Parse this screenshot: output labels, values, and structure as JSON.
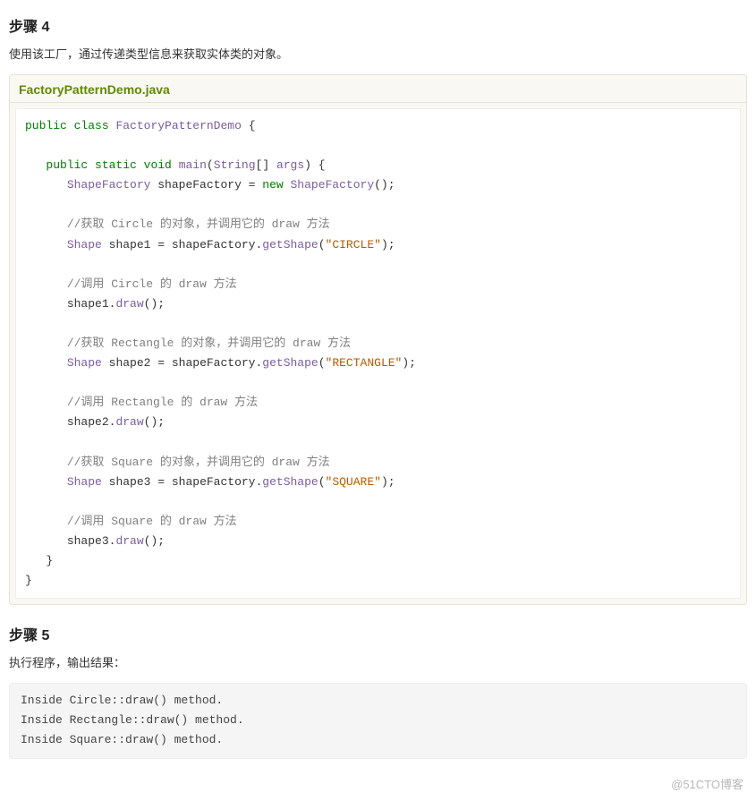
{
  "step4": {
    "heading": "步骤 4",
    "desc": "使用该工厂，通过传递类型信息来获取实体类的对象。",
    "filename": "FactoryPatternDemo.java",
    "code": {
      "kw_public": "public",
      "kw_class": "class",
      "cls_FactoryPatternDemo": "FactoryPatternDemo",
      "kw_static": "static",
      "kw_void": "void",
      "fn_main": "main",
      "type_String": "String",
      "arg_args": "args",
      "type_ShapeFactory": "ShapeFactory",
      "var_shapeFactory": "shapeFactory",
      "kw_new": "new",
      "cmt_getCircle": "//获取 Circle 的对象，并调用它的 draw 方法",
      "type_Shape": "Shape",
      "var_shape1": "shape1",
      "fn_getShape": "getShape",
      "str_CIRCLE": "\"CIRCLE\"",
      "cmt_callCircle": "//调用 Circle 的 draw 方法",
      "fn_draw": "draw",
      "cmt_getRect": "//获取 Rectangle 的对象，并调用它的 draw 方法",
      "var_shape2": "shape2",
      "str_RECTANGLE": "\"RECTANGLE\"",
      "cmt_callRect": "//调用 Rectangle 的 draw 方法",
      "cmt_getSquare": "//获取 Square 的对象，并调用它的 draw 方法",
      "var_shape3": "shape3",
      "str_SQUARE": "\"SQUARE\"",
      "cmt_callSquare": "//调用 Square 的 draw 方法"
    }
  },
  "step5": {
    "heading": "步骤 5",
    "desc": "执行程序，输出结果：",
    "output_lines": [
      "Inside Circle::draw() method.",
      "Inside Rectangle::draw() method.",
      "Inside Square::draw() method."
    ]
  },
  "watermark": "@51CTO博客"
}
